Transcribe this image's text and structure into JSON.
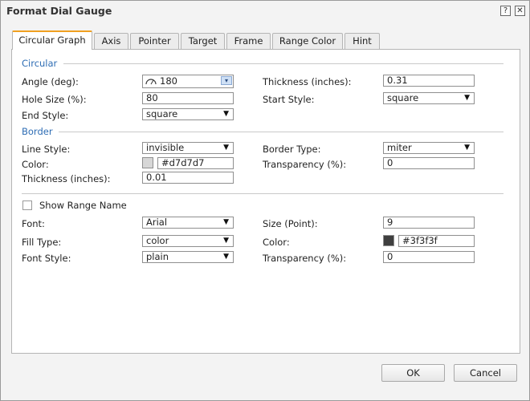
{
  "window": {
    "title": "Format Dial Gauge",
    "help_glyph": "?",
    "close_glyph": "✕"
  },
  "tabs": [
    {
      "label": "Circular Graph",
      "active": true
    },
    {
      "label": "Axis"
    },
    {
      "label": "Pointer"
    },
    {
      "label": "Target"
    },
    {
      "label": "Frame"
    },
    {
      "label": "Range Color"
    },
    {
      "label": "Hint"
    }
  ],
  "circular": {
    "section": "Circular",
    "angle_label": "Angle (deg):",
    "angle_value": "180",
    "thickness_label": "Thickness (inches):",
    "thickness_value": "0.31",
    "hole_size_label": "Hole Size (%):",
    "hole_size_value": "80",
    "start_style_label": "Start Style:",
    "start_style_value": "square",
    "end_style_label": "End Style:",
    "end_style_value": "square"
  },
  "border": {
    "section": "Border",
    "line_style_label": "Line Style:",
    "line_style_value": "invisible",
    "border_type_label": "Border Type:",
    "border_type_value": "miter",
    "color_label": "Color:",
    "color_value": "#d7d7d7",
    "transparency_label": "Transparency (%):",
    "transparency_value": "0",
    "thickness_label": "Thickness (inches):",
    "thickness_value": "0.01"
  },
  "range_name": {
    "show_label": "Show Range Name",
    "checked": false,
    "font_label": "Font:",
    "font_value": "Arial",
    "size_label": "Size (Point):",
    "size_value": "9",
    "fill_type_label": "Fill Type:",
    "fill_type_value": "color",
    "color_label": "Color:",
    "color_value": "#3f3f3f",
    "font_style_label": "Font Style:",
    "font_style_value": "plain",
    "transparency_label": "Transparency (%):",
    "transparency_value": "0"
  },
  "footer": {
    "ok_label": "OK",
    "cancel_label": "Cancel"
  },
  "glyphs": {
    "dropdown_arrow": "▼",
    "combo_arrow": "▾"
  }
}
